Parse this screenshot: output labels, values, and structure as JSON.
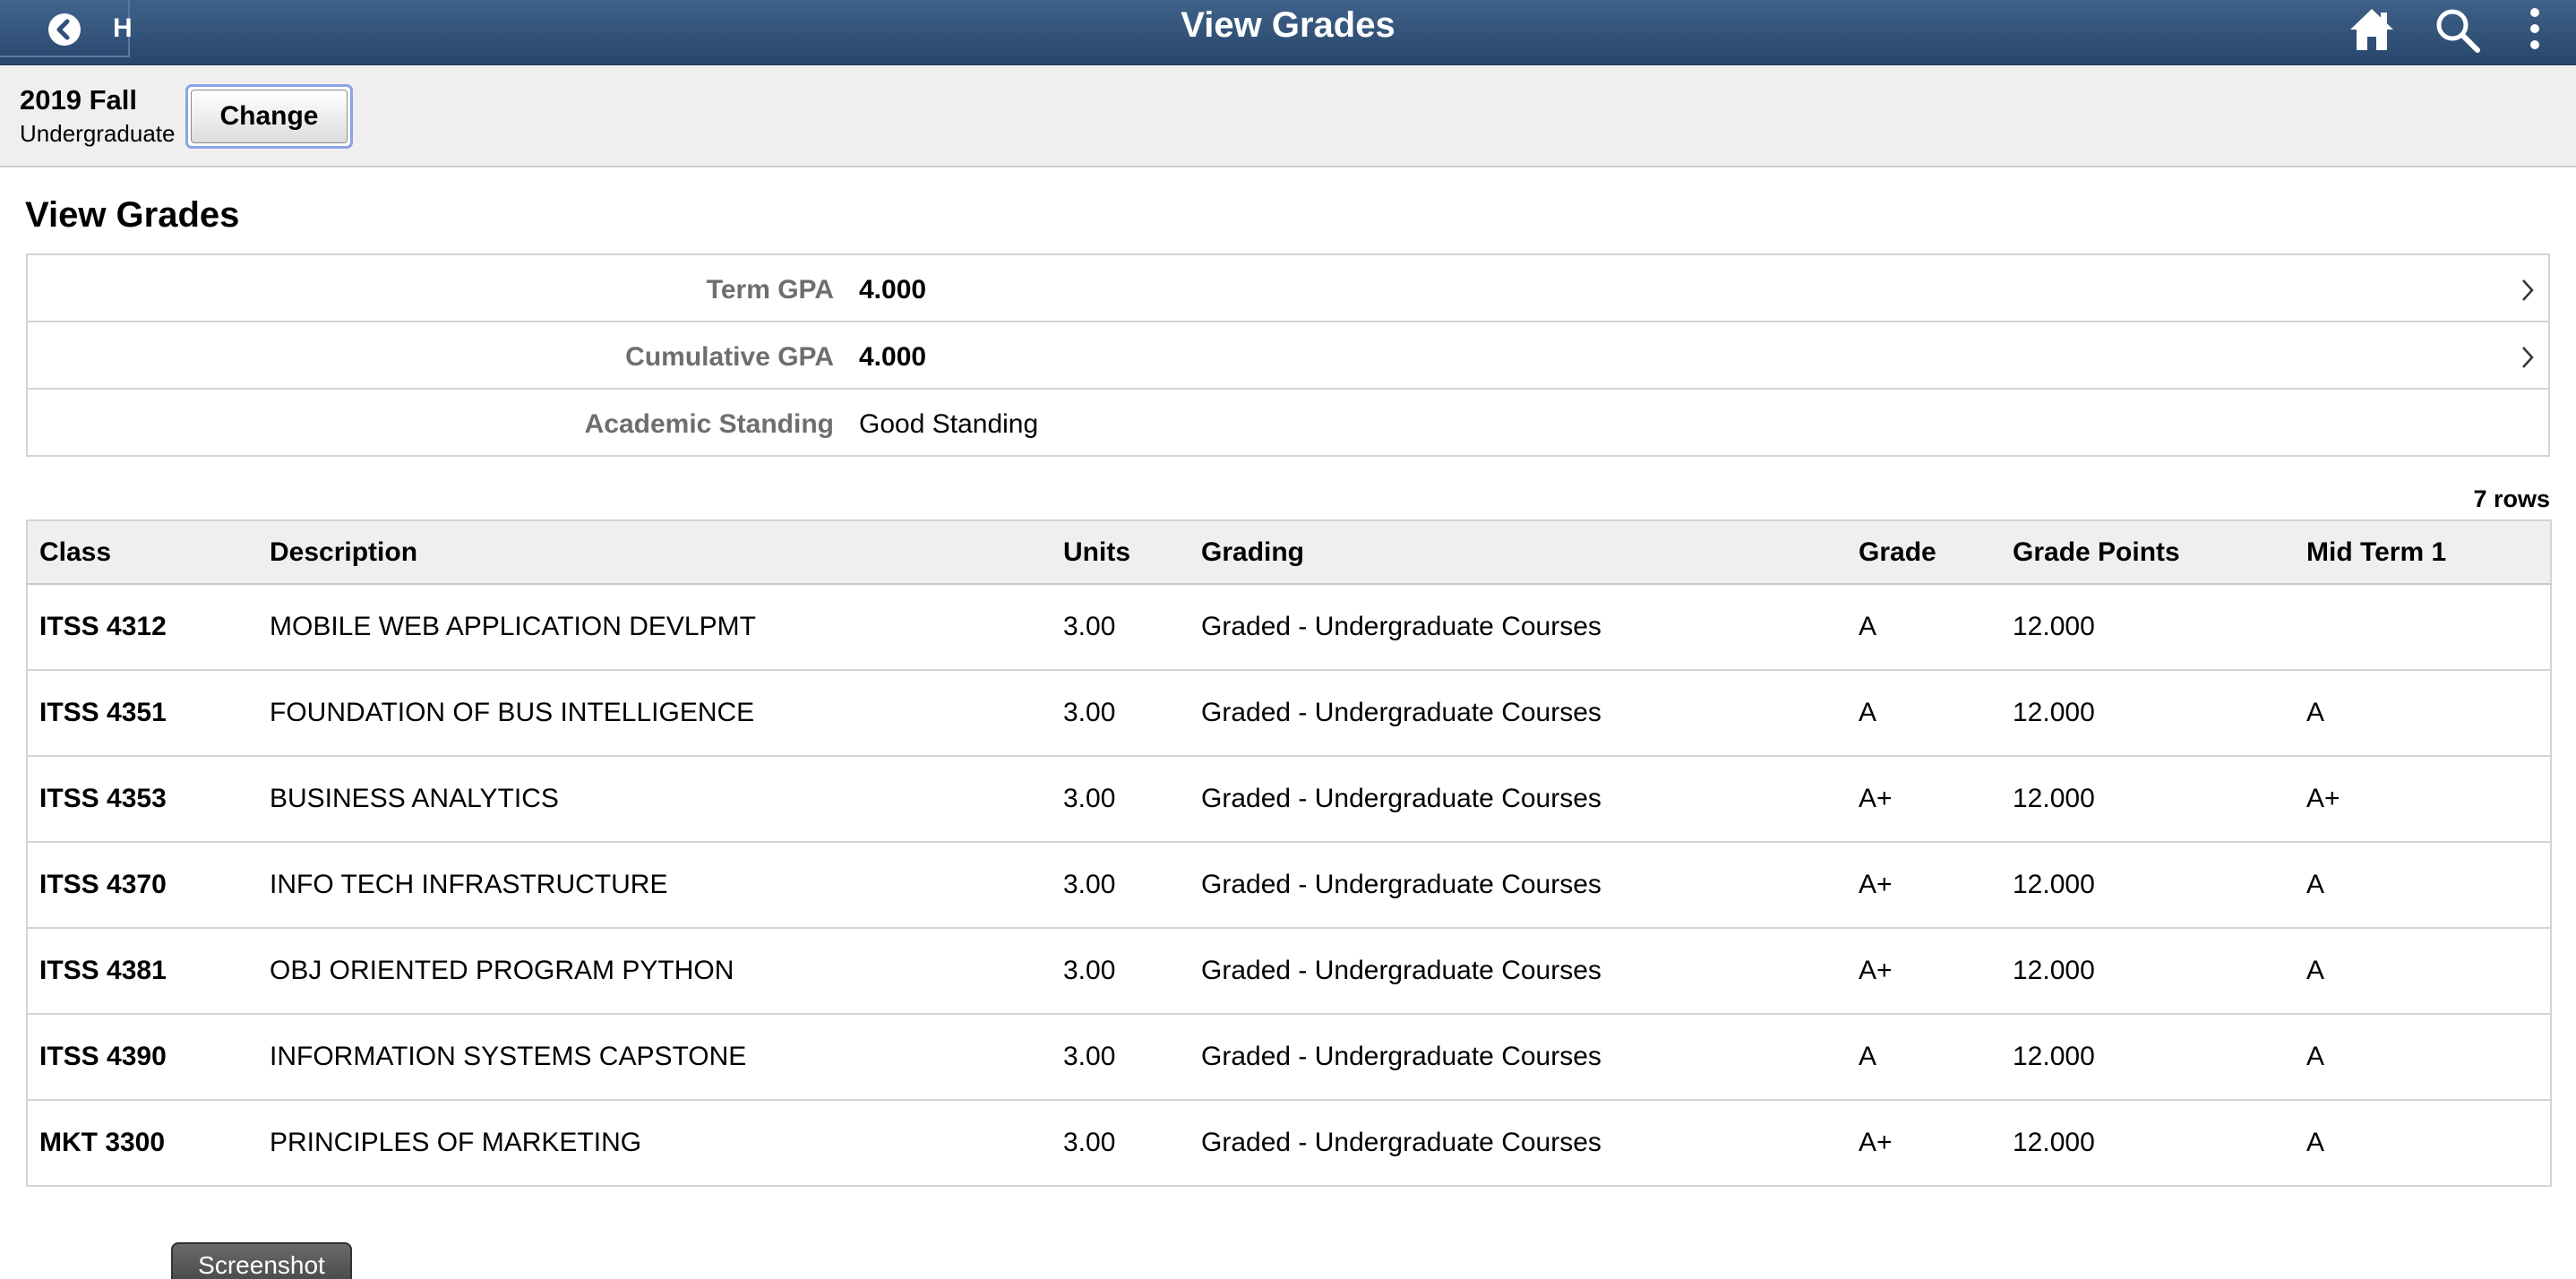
{
  "header": {
    "back_label": "H",
    "title": "View Grades",
    "icons": [
      "back-icon",
      "home-icon",
      "search-icon",
      "more-icon"
    ]
  },
  "term": {
    "name": "2019 Fall",
    "career": "Undergraduate",
    "change_label": "Change"
  },
  "page_title": "View Grades",
  "gpa": [
    {
      "label": "Term GPA",
      "value": "4.000"
    },
    {
      "label": "Cumulative GPA",
      "value": "4.000"
    },
    {
      "label": "Academic Standing",
      "value": "Good Standing"
    }
  ],
  "rows_count": "7 rows",
  "table": {
    "columns": [
      "Class",
      "Description",
      "Units",
      "Grading",
      "Grade",
      "Grade Points",
      "Mid Term 1"
    ],
    "rows": [
      [
        "ITSS 4312",
        "MOBILE WEB APPLICATION DEVLPMT",
        "3.00",
        "Graded - Undergraduate Courses",
        "A",
        "12.000",
        ""
      ],
      [
        "ITSS 4351",
        "FOUNDATION OF BUS INTELLIGENCE",
        "3.00",
        "Graded - Undergraduate Courses",
        "A",
        "12.000",
        "A"
      ],
      [
        "ITSS 4353",
        "BUSINESS ANALYTICS",
        "3.00",
        "Graded - Undergraduate Courses",
        "A+",
        "12.000",
        "A+"
      ],
      [
        "ITSS 4370",
        "INFO TECH INFRASTRUCTURE",
        "3.00",
        "Graded - Undergraduate Courses",
        "A+",
        "12.000",
        "A"
      ],
      [
        "ITSS 4381",
        "OBJ ORIENTED PROGRAM PYTHON",
        "3.00",
        "Graded - Undergraduate Courses",
        "A+",
        "12.000",
        "A"
      ],
      [
        "ITSS 4390",
        "INFORMATION SYSTEMS CAPSTONE",
        "3.00",
        "Graded - Undergraduate Courses",
        "A",
        "12.000",
        "A"
      ],
      [
        "MKT 3300",
        "PRINCIPLES OF MARKETING",
        "3.00",
        "Graded - Undergraduate Courses",
        "A+",
        "12.000",
        "A"
      ]
    ]
  },
  "screenshot_label": "Screenshot",
  "colors": {
    "header": "#2f4f77",
    "focus_ring": "#8aa3e6",
    "banner_bg": "#efefef"
  }
}
